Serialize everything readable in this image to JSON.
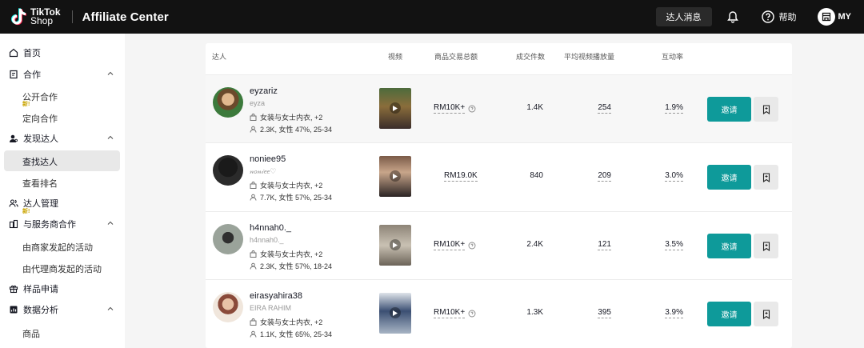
{
  "header": {
    "logo_line1": "TikTok",
    "logo_line2": "Shop",
    "title": "Affiliate Center",
    "messages_label": "达人消息",
    "help_label": "帮助",
    "region": "MY"
  },
  "sidebar": {
    "items": [
      {
        "label": "首页",
        "icon": "home-icon"
      },
      {
        "label": "合作",
        "icon": "document-icon"
      },
      {
        "label": "公开合作",
        "badge": "新!"
      },
      {
        "label": "定向合作"
      },
      {
        "label": "发现达人",
        "icon": "person-search-icon"
      },
      {
        "label": "查找达人",
        "active": true
      },
      {
        "label": "查看排名"
      },
      {
        "label": "达人管理",
        "icon": "people-icon",
        "badge": "新!"
      },
      {
        "label": "与服务商合作",
        "icon": "handshake-icon"
      },
      {
        "label": "由商家发起的活动"
      },
      {
        "label": "由代理商发起的活动"
      },
      {
        "label": "样品申请",
        "icon": "gift-icon"
      },
      {
        "label": "数据分析",
        "icon": "chart-icon"
      },
      {
        "label": "商品"
      }
    ]
  },
  "table": {
    "columns": [
      "达人",
      "视频",
      "商品交易总额",
      "成交件数",
      "平均视频播放量",
      "互动率"
    ],
    "invite_label": "邀请",
    "rows": [
      {
        "name": "eyzariz",
        "handle": "eyza",
        "category": "女装与女士内衣, +2",
        "stats": "2.3K, 女性 47%, 25-34",
        "gmv": "RM10K+",
        "gmv_info": true,
        "items_sold": "1.4K",
        "avg_views": "254",
        "engagement": "1.9%"
      },
      {
        "name": "noniee95",
        "handle": "𝓃𝑜𝓃𝒾𝑒𝑒♡",
        "category": "女装与女士内衣, +2",
        "stats": "7.7K, 女性 57%, 25-34",
        "gmv": "RM19.0K",
        "gmv_info": false,
        "items_sold": "840",
        "avg_views": "209",
        "engagement": "3.0%"
      },
      {
        "name": "h4nnah0._",
        "handle": "h4nnah0._",
        "category": "女装与女士内衣, +2",
        "stats": "2.3K, 女性 57%, 18-24",
        "gmv": "RM10K+",
        "gmv_info": true,
        "items_sold": "2.4K",
        "avg_views": "121",
        "engagement": "3.5%"
      },
      {
        "name": "eirasyahira38",
        "handle": "EIRA RAHIM",
        "category": "女装与女士内衣, +2",
        "stats": "1.1K, 女性 65%, 25-34",
        "gmv": "RM10K+",
        "gmv_info": true,
        "items_sold": "1.3K",
        "avg_views": "395",
        "engagement": "3.9%"
      }
    ]
  },
  "colors": {
    "topbar": "#121212",
    "accent": "#0e9a9a",
    "new_badge": "#c9a400"
  }
}
